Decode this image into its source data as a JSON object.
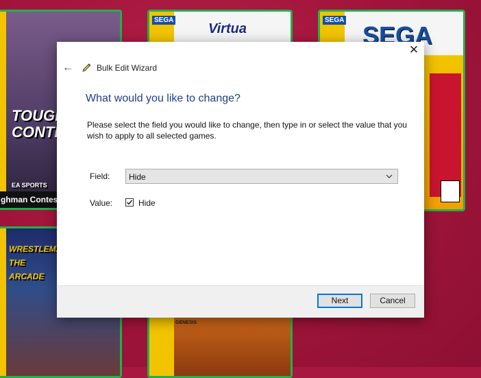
{
  "background": {
    "tiles": [
      {
        "caption": "ghman Contest",
        "title": "TOUGH CONTEST",
        "brand": "EA SPORTS"
      },
      {
        "brand": "SEGA",
        "title": "Virtua"
      },
      {
        "brand": "SEGA",
        "title": "SEGA"
      },
      {
        "title": "WRESTLEMANIA THE ARCADE"
      },
      {
        "brand": "GENESIS"
      }
    ]
  },
  "dialog": {
    "title": "Bulk Edit Wizard",
    "close_glyph": "✕",
    "back_glyph": "←",
    "heading": "What would you like to change?",
    "instructions": "Please select the field you would like to change, then type in or select the value that you wish to apply to all selected games.",
    "field_label": "Field:",
    "field_value": "Hide",
    "value_label": "Value:",
    "checkbox_label": "Hide",
    "checkbox_checked": true,
    "next_label": "Next",
    "cancel_label": "Cancel"
  },
  "colors": {
    "accent": "#0078d7",
    "heading": "#1e3f8a",
    "tile_border": "#22b14c"
  }
}
